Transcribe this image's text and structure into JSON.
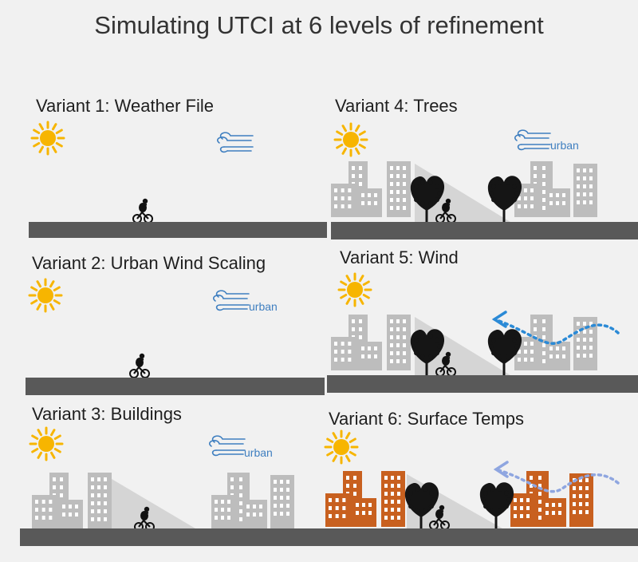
{
  "title": "Simulating UTCI at 6 levels of refinement",
  "panels": [
    {
      "label": "Variant 1: Weather File",
      "wind_tag": ""
    },
    {
      "label": "Variant 2: Urban Wind Scaling",
      "wind_tag": "urban"
    },
    {
      "label": "Variant 3: Buildings",
      "wind_tag": "urban"
    },
    {
      "label": "Variant 4: Trees",
      "wind_tag": "urban"
    },
    {
      "label": "Variant 5: Wind",
      "wind_tag": ""
    },
    {
      "label": "Variant 6: Surface Temps",
      "wind_tag": ""
    }
  ],
  "colors": {
    "sun": "#f7b500",
    "ground": "#595959",
    "building": "#bdbdbd",
    "building_hot": "#c8601f",
    "shadow": "#d5d5d5",
    "wind_icon": "#3f7fc0",
    "wind_arrow": "#2b8ad6",
    "wind_arrow_light": "#8fa6e0",
    "tree": "#151515",
    "window": "#ffffff"
  }
}
